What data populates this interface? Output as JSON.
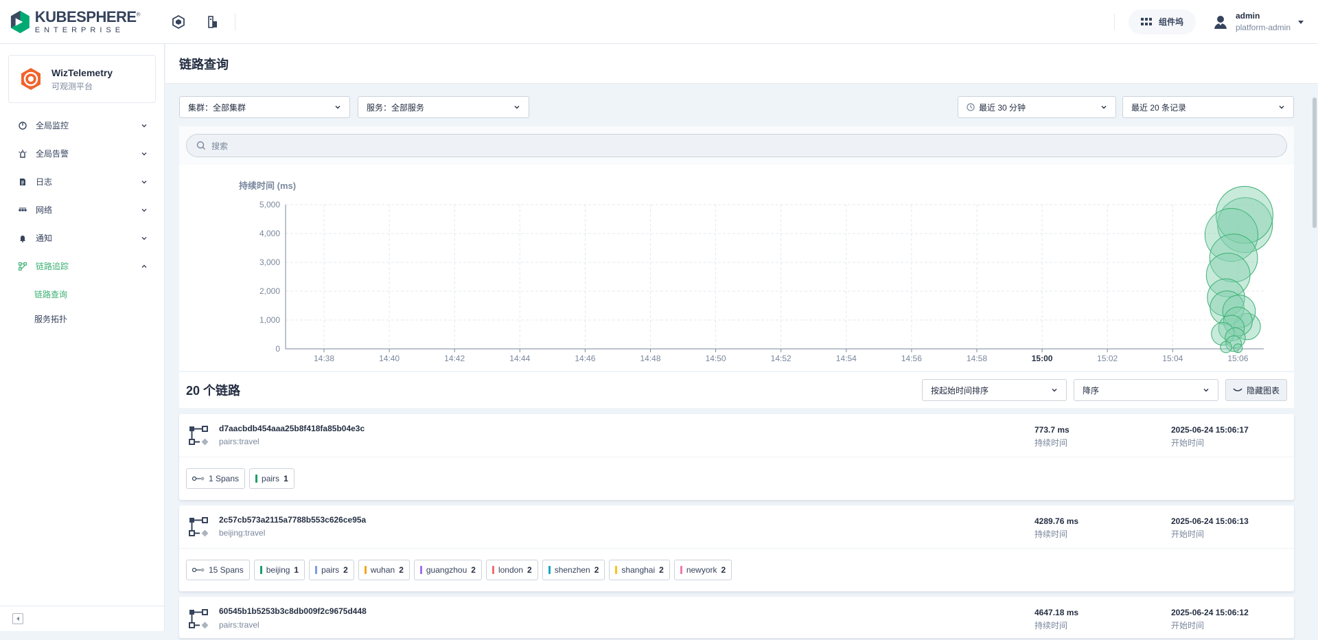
{
  "header": {
    "logo_main": "KUBESPHERE",
    "logo_reg": "®",
    "logo_sub": "ENTERPRISE",
    "component_label": "组件坞",
    "user_name": "admin",
    "user_role": "platform-admin"
  },
  "sidebar": {
    "app_name": "WizTelemetry",
    "app_sub": "可观测平台",
    "items": [
      {
        "label": "全局监控",
        "icon": "monitor-icon"
      },
      {
        "label": "全局告警",
        "icon": "alarm-icon"
      },
      {
        "label": "日志",
        "icon": "log-icon"
      },
      {
        "label": "网络",
        "icon": "network-icon"
      },
      {
        "label": "通知",
        "icon": "bell-icon"
      },
      {
        "label": "链路追踪",
        "icon": "trace-icon"
      }
    ],
    "sub_items": [
      {
        "label": "链路查询"
      },
      {
        "label": "服务拓扑"
      }
    ]
  },
  "page": {
    "title": "链路查询"
  },
  "filters": {
    "cluster": "集群：全部集群",
    "service": "服务：全部服务",
    "time_range": "最近 30 分钟",
    "limit": "最近 20 条记录"
  },
  "search": {
    "placeholder": "搜索"
  },
  "chart_data": {
    "type": "scatter",
    "ylabel": "持续时间 (ms)",
    "xlabel": "",
    "x_ticks": [
      "14:38",
      "14:40",
      "14:42",
      "14:44",
      "14:46",
      "14:48",
      "14:50",
      "14:52",
      "14:54",
      "14:56",
      "14:58",
      "15:00",
      "15:02",
      "15:04",
      "15:06"
    ],
    "y_ticks": [
      "0",
      "1,000",
      "2,000",
      "3,000",
      "4,000",
      "5,000"
    ],
    "ylim": [
      0,
      5000
    ],
    "grid": true,
    "series": [
      {
        "points": [
          {
            "t": "15:06:17",
            "duration": 773.7
          },
          {
            "t": "15:06:13",
            "duration": 4289.76
          },
          {
            "t": "15:06:12",
            "duration": 4647.18
          },
          {
            "t": "15:05:48",
            "duration": 3950
          },
          {
            "t": "15:05:52",
            "duration": 3150
          },
          {
            "t": "15:05:42",
            "duration": 2560
          },
          {
            "t": "15:05:38",
            "duration": 1780
          },
          {
            "t": "15:05:40",
            "duration": 1420
          },
          {
            "t": "15:06:02",
            "duration": 1300
          },
          {
            "t": "15:06:00",
            "duration": 950
          },
          {
            "t": "15:05:48",
            "duration": 720
          },
          {
            "t": "15:05:32",
            "duration": 520
          },
          {
            "t": "15:05:55",
            "duration": 380
          },
          {
            "t": "15:05:52",
            "duration": 180
          },
          {
            "t": "15:05:38",
            "duration": 60
          },
          {
            "t": "15:06:00",
            "duration": 20
          }
        ]
      }
    ]
  },
  "list": {
    "count_title": "20 个链路",
    "sort_by": "按起始时间排序",
    "order": "降序",
    "hide_chart": "隐藏图表"
  },
  "traces": [
    {
      "id": "d7aacbdb454aaa25b8f418fa85b04e3c",
      "service": "pairs:travel",
      "duration": "773.7 ms",
      "duration_label": "持续时间",
      "start": "2025-06-24 15:06:17",
      "start_label": "开始时间",
      "spans": "1 Spans",
      "tags": [
        {
          "name": "pairs",
          "count": "1",
          "color": "#1a9c6b"
        }
      ]
    },
    {
      "id": "2c57cb573a2115a7788b553c626ce95a",
      "service": "beijing:travel",
      "duration": "4289.76 ms",
      "duration_label": "持续时间",
      "start": "2025-06-24 15:06:13",
      "start_label": "开始时间",
      "spans": "15 Spans",
      "tags": [
        {
          "name": "beijing",
          "count": "1",
          "color": "#1a9c6b"
        },
        {
          "name": "pairs",
          "count": "2",
          "color": "#7a9be6"
        },
        {
          "name": "wuhan",
          "count": "2",
          "color": "#f5a623"
        },
        {
          "name": "guangzhou",
          "count": "2",
          "color": "#a66cf0"
        },
        {
          "name": "london",
          "count": "2",
          "color": "#ee6f6f"
        },
        {
          "name": "shenzhen",
          "count": "2",
          "color": "#1ba3c4"
        },
        {
          "name": "shanghai",
          "count": "2",
          "color": "#f5c518"
        },
        {
          "name": "newyork",
          "count": "2",
          "color": "#f07aa8"
        }
      ]
    },
    {
      "id": "60545b1b5253b3c8db009f2c9675d448",
      "service": "pairs:travel",
      "duration": "4647.18 ms",
      "duration_label": "持续时间",
      "start": "2025-06-24 15:06:12",
      "start_label": "开始时间"
    }
  ]
}
